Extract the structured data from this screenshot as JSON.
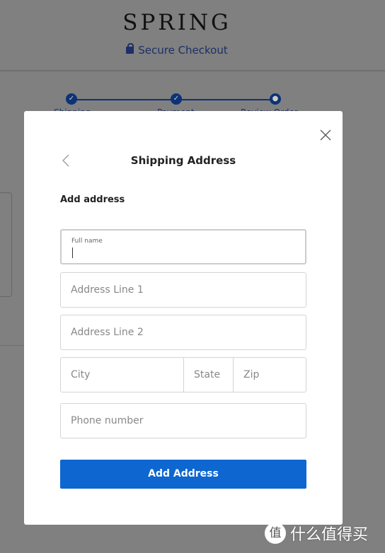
{
  "header": {
    "brand": "SPRING",
    "secure_label": "Secure Checkout",
    "lock_icon": "lock-icon"
  },
  "steps": [
    {
      "label": "Shipping",
      "state": "done"
    },
    {
      "label": "Payment",
      "state": "done"
    },
    {
      "label": "Review Order",
      "state": "current"
    }
  ],
  "colors": {
    "accent": "#0e66d0",
    "navy": "#0d3275",
    "overlay": "#808080"
  },
  "modal": {
    "title": "Shipping Address",
    "subtitle": "Add address",
    "fields": {
      "full_name": {
        "label": "Full name",
        "value": ""
      },
      "address1": {
        "placeholder": "Address Line 1"
      },
      "address2": {
        "placeholder": "Address Line 2"
      },
      "city": {
        "placeholder": "City"
      },
      "state": {
        "placeholder": "State"
      },
      "zip": {
        "placeholder": "Zip"
      },
      "phone": {
        "placeholder": "Phone number"
      }
    },
    "submit_label": "Add Address"
  },
  "watermark": {
    "logo": "值",
    "text": "什么值得买"
  }
}
